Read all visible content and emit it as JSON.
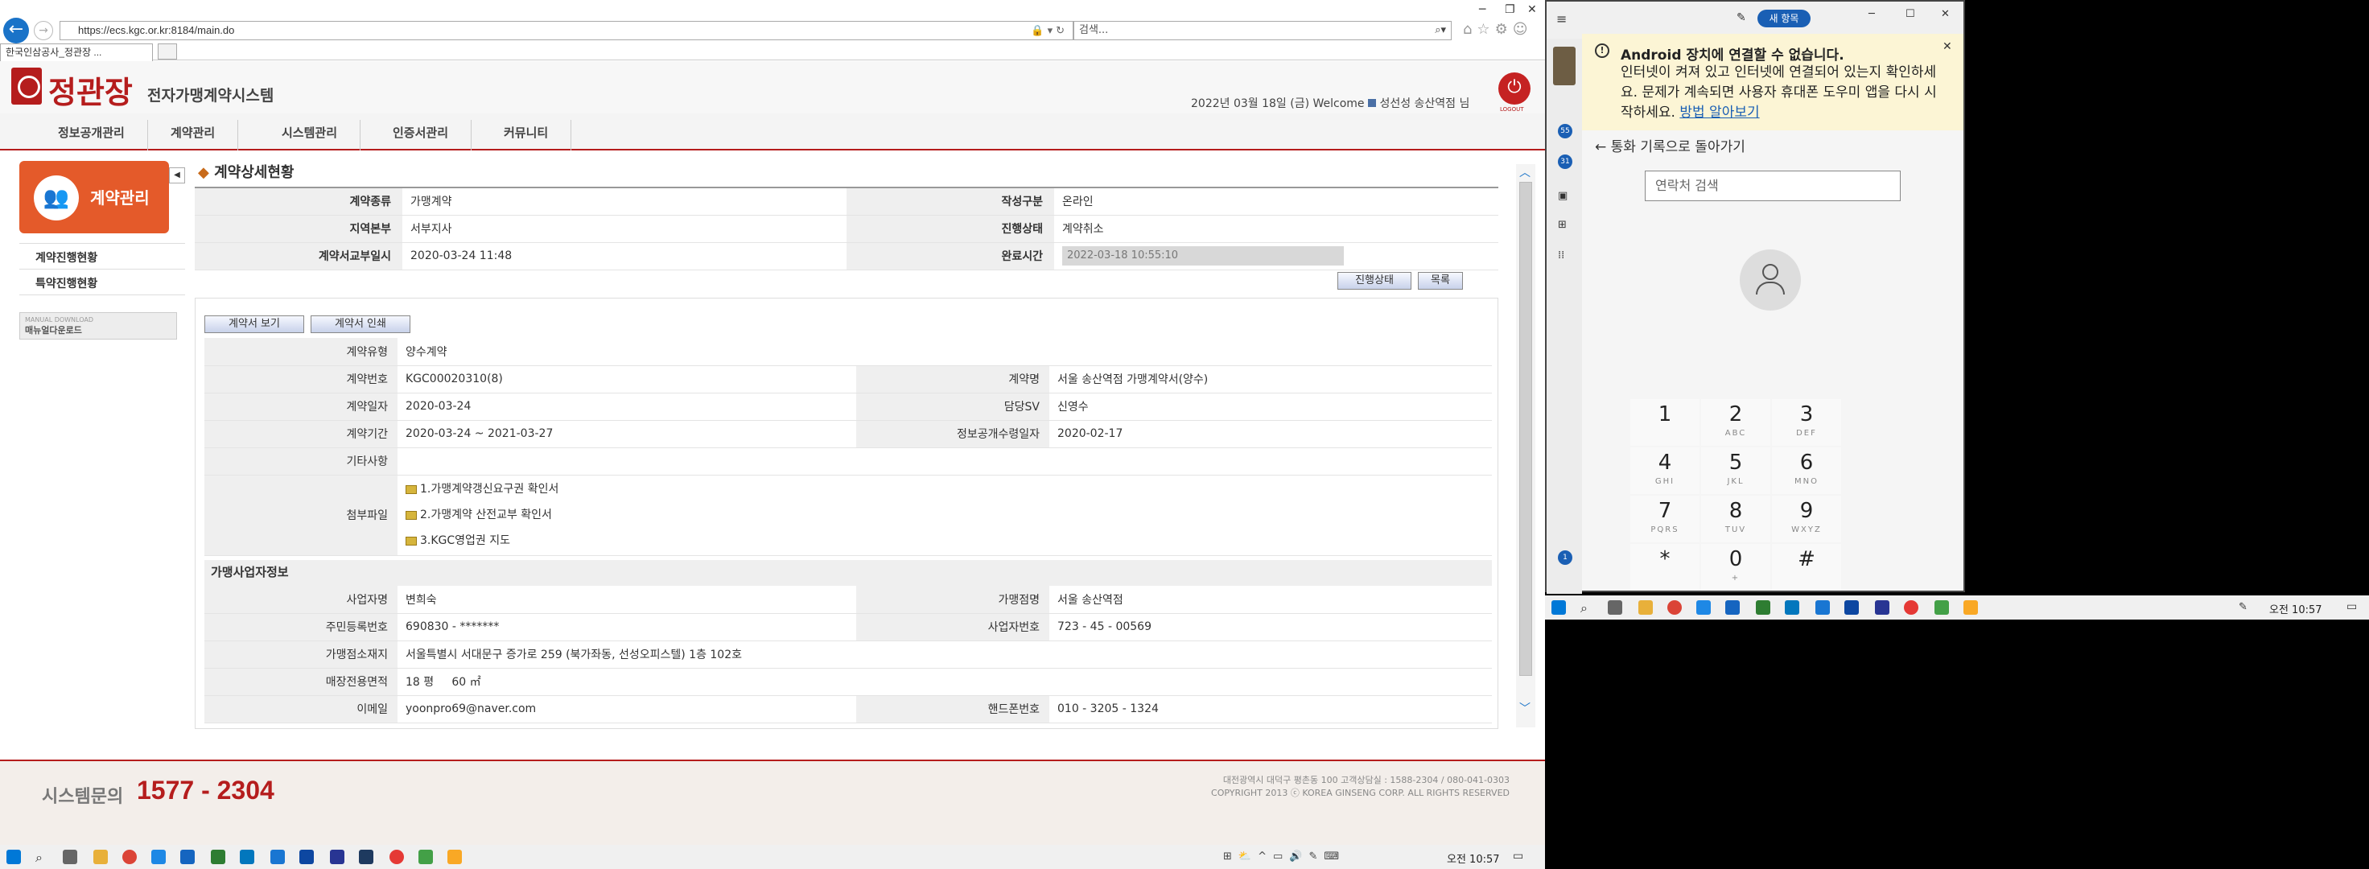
{
  "browser": {
    "url": "https://ecs.kgc.or.kr:8184/main.do",
    "search_placeholder": "검색...",
    "tab_title": "한국인삼공사_정관장 ..."
  },
  "header": {
    "logo": "정관장",
    "system_name": "전자가맹계약시스템",
    "welcome": "2022년 03월 18일 (금) Welcome",
    "user": "성선성 송산역점 님",
    "logout_label": "LOGOUT"
  },
  "menu": [
    "정보공개관리",
    "계약관리",
    "시스템관리",
    "인증서관리",
    "커뮤니티"
  ],
  "sidebar": {
    "title": "계약관리",
    "items": [
      "계약진행현황",
      "특약진행현황"
    ],
    "manual": "매뉴얼다운로드",
    "manual_small": "MANUAL DOWNLOAD"
  },
  "page_title": "계약상세현황",
  "summary": {
    "contract_type_label": "계약종류",
    "contract_type": "가맹계약",
    "write_type_label": "작성구분",
    "write_type": "온라인",
    "region_label": "지역본부",
    "region": "서부지사",
    "status_label": "진행상태",
    "status": "계약취소",
    "sent_label": "계약서교부일시",
    "sent": "2020-03-24 11:48",
    "signed_label": "완료시간",
    "signed": "2022-03-18 10:55:10",
    "btn_progress": "진행상태",
    "btn_list": "목록"
  },
  "detail": {
    "btn_view": "계약서 보기",
    "btn_print": "계약서 인쇄",
    "type_label": "계약유형",
    "type": "양수계약",
    "no_label": "계약번호",
    "no": "KGC00020310(8)",
    "name_label": "계약명",
    "name": "서울 송산역점 가맹계약서(양수)",
    "date_label": "계약일자",
    "date": "2020-03-24",
    "sv_label": "담당SV",
    "sv": "신영수",
    "period_label": "계약기간",
    "period": "2020-03-24 ~ 2021-03-27",
    "disclosure_label": "정보공개수령일자",
    "disclosure": "2020-02-17",
    "etc_label": "기타사항",
    "files_label": "첨부파일",
    "files": [
      "1.가맹계약갱신요구권 확인서",
      "2.가맹계약 산전교부 확인서",
      "3.KGC영업권 지도"
    ]
  },
  "franchisee": {
    "section": "가맹사업자정보",
    "owner_label": "사업자명",
    "owner": "변희숙",
    "store_label": "가맹점명",
    "store": "서울 송산역점",
    "rrn_label": "주민등록번호",
    "rrn": "690830 - *******",
    "biz_label": "사업자번호",
    "biz": "723 - 45 - 00569",
    "address_label": "가맹점소재지",
    "address": "서울특별시 서대문구 증가로 259 (북가좌동, 선성오피스텔) 1층 102호",
    "area_label": "매장전용면적",
    "area": "18 평     60 ㎡",
    "email_label": "이메일",
    "email": "yoonpro69@naver.com",
    "mobile_label": "핸드폰번호",
    "mobile": "010 - 3205 - 1324"
  },
  "footer": {
    "help_label": "시스템문의",
    "help_number": "1577 - 2304",
    "address": "대전광역시 대덕구 평촌동 100    고객상담실 : 1588-2304 / 080-041-0303",
    "copyright": "COPYRIGHT 2013 ⓒ KOREA GINSENG CORP. ALL RIGHTS RESERVED"
  },
  "phone_app": {
    "new_item": "새 항목",
    "banner_title": "Android 장치에 연결할 수 없습니다.",
    "banner_body": "인터넷이 켜져 있고 인터넷에 연결되어 있는지 확인하세요. 문제가 계속되면 사용자 휴대폰 도우미 앱을 다시 시작하세요.",
    "banner_link": "방법 알아보기",
    "back": "통화 기록으로 돌아가기",
    "search_placeholder": "연락처 검색",
    "badge_msgs": "55",
    "badge_calls": "31",
    "badge_bottom": "1",
    "keys": [
      {
        "n": "1",
        "l": ""
      },
      {
        "n": "2",
        "l": "ABC"
      },
      {
        "n": "3",
        "l": "DEF"
      },
      {
        "n": "4",
        "l": "GHI"
      },
      {
        "n": "5",
        "l": "JKL"
      },
      {
        "n": "6",
        "l": "MNO"
      },
      {
        "n": "7",
        "l": "PQRS"
      },
      {
        "n": "8",
        "l": "TUV"
      },
      {
        "n": "9",
        "l": "WXYZ"
      },
      {
        "n": "*",
        "l": ""
      },
      {
        "n": "0",
        "l": "+"
      },
      {
        "n": "#",
        "l": ""
      }
    ]
  },
  "taskbar": {
    "clock_left": "오전 10:57",
    "clock_right": "오전 10:57"
  }
}
